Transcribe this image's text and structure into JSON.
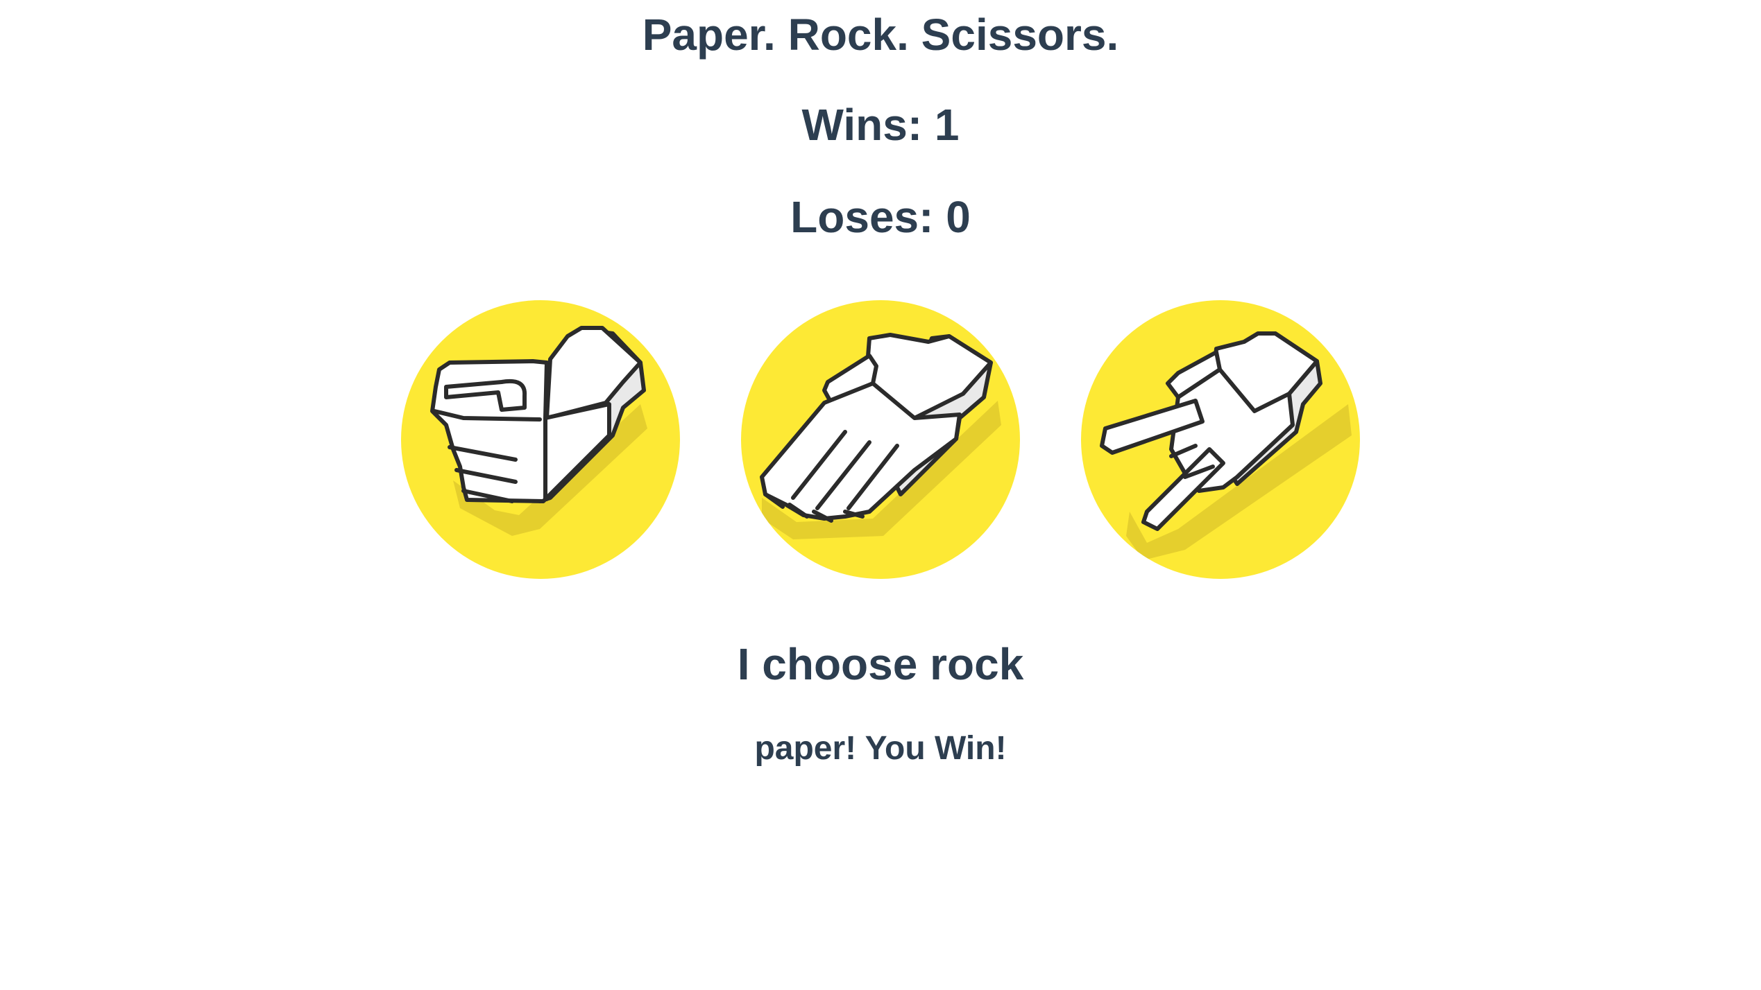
{
  "game": {
    "title": "Paper. Rock. Scissors.",
    "wins_text": "Wins: 1",
    "loses_text": "Loses: 0"
  },
  "score": {
    "wins": 1,
    "loses": 0
  },
  "options": [
    {
      "name": "rock",
      "icon": "fist-icon"
    },
    {
      "name": "paper",
      "icon": "open-hand-icon"
    },
    {
      "name": "scissors",
      "icon": "peace-sign-icon"
    }
  ],
  "status": {
    "choice_text": "I choose rock",
    "result_text": "paper! You Win!"
  },
  "colors": {
    "text": "#2d3e50",
    "circle": "#fde935",
    "circle_shadow": "#e8d12e",
    "hand": "#ffffff",
    "hand_shade": "#e9e9e9",
    "outline": "#2b2b2b"
  }
}
